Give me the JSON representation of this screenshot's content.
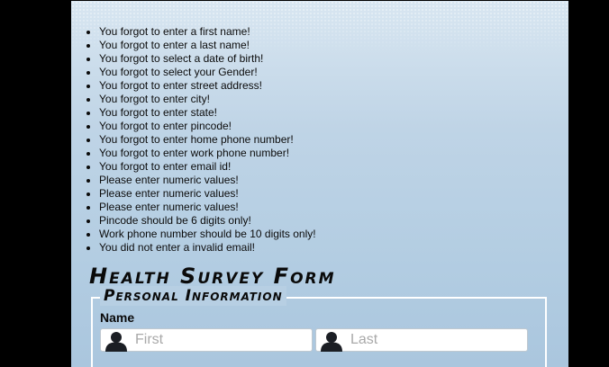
{
  "errors": [
    "You forgot to enter a first name!",
    "You forgot to enter a last name!",
    "You forgot to select a date of birth!",
    "You forgot to select your Gender!",
    "You forgot to enter street address!",
    "You forgot to enter city!",
    "You forgot to enter state!",
    "You forgot to enter pincode!",
    "You forgot to enter home phone number!",
    "You forgot to enter work phone number!",
    "You forgot to enter email id!",
    "Please enter numeric values!",
    "Please enter numeric values!",
    "Please enter numeric values!",
    "Pincode should be 6 digits only!",
    "Work phone number should be 10 digits only!",
    "You did not enter a invalid email!"
  ],
  "form": {
    "title": "Health Survey Form",
    "section_legend": "Personal Information",
    "name_label": "Name",
    "first_placeholder": "First",
    "last_placeholder": "Last",
    "first_icon": "person-silhouette-icon",
    "last_icon": "person-silhouette-icon"
  },
  "colors": {
    "page_background": "#000000",
    "panel_gradient_top": "#d8e6f1",
    "panel_gradient_bottom": "#aac6de",
    "fieldset_border": "#ffffff",
    "placeholder_text": "#a9a9a9"
  }
}
